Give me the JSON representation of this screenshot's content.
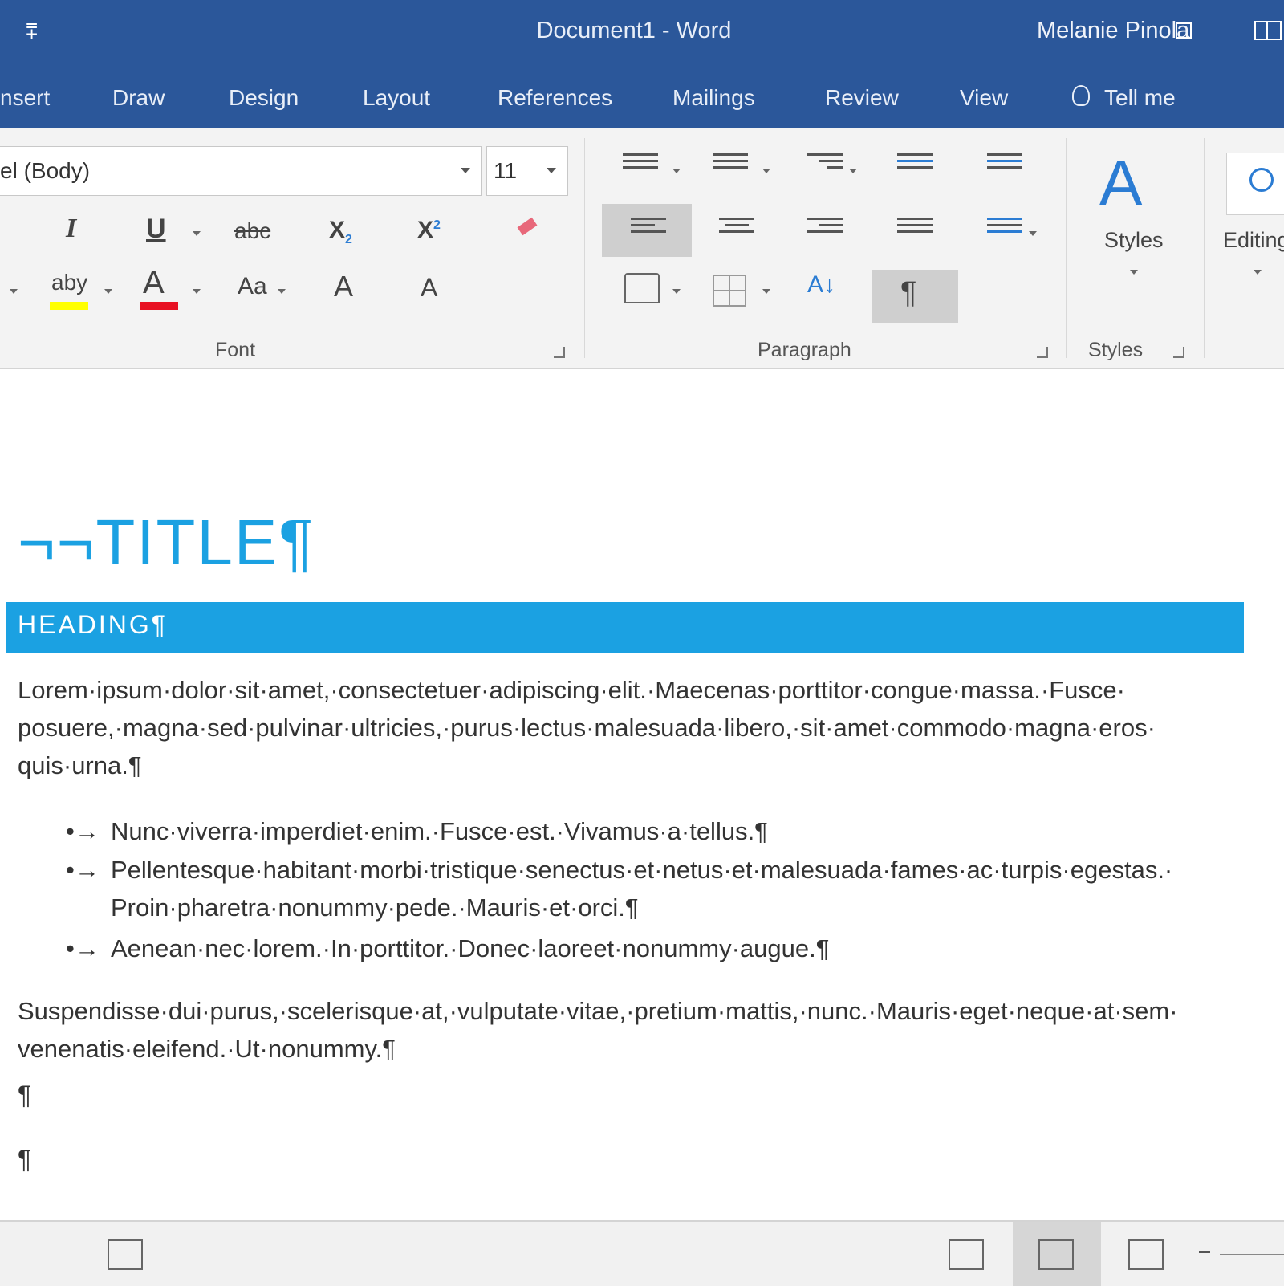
{
  "window": {
    "title": "Document1 - Word",
    "user": "Melanie Pinola",
    "qat_glyph": "⩱"
  },
  "tabs": [
    "nsert",
    "Draw",
    "Design",
    "Layout",
    "References",
    "Mailings",
    "Review",
    "View",
    "Tell me"
  ],
  "font": {
    "name": "el (Body)",
    "size": "11"
  },
  "groups": {
    "font": "Font",
    "paragraph": "Paragraph",
    "styles": "Styles",
    "editing": "Editing",
    "styles_button": "Styles"
  },
  "font_buttons": {
    "italic": "I",
    "underline": "U",
    "strike": "abc",
    "sub": "X",
    "sub_small": "2",
    "super": "X",
    "super_small": "2",
    "highlight": "aby",
    "color": "A",
    "case": "Aa",
    "grow": "A",
    "shrink": "A"
  },
  "paragraph_buttons": {
    "sort": "A↓",
    "show_marks": "¶"
  },
  "document": {
    "title": "¬¬TITLE¶",
    "heading": "HEADING¶",
    "para1": "Lorem·ipsum·dolor·sit·amet,·consectetuer·adipiscing·elit.·Maecenas·porttitor·congue·massa.·Fusce· posuere,·magna·sed·pulvinar·ultricies,·purus·lectus·malesuada·libero,·sit·amet·commodo·magna·eros· quis·urna.¶",
    "bullets": [
      "Nunc·viverra·imperdiet·enim.·Fusce·est.·Vivamus·a·tellus.¶",
      "Pellentesque·habitant·morbi·tristique·senectus·et·netus·et·malesuada·fames·ac·turpis·egestas.· Proin·pharetra·nonummy·pede.·Mauris·et·orci.¶",
      "Aenean·nec·lorem.·In·porttitor.·Donec·laoreet·nonummy·augue.¶"
    ],
    "bullet_marker": "•→",
    "para2": "Suspendisse·dui·purus,·scelerisque·at,·vulputate·vitae,·pretium·mattis,·nunc.·Mauris·eget·neque·at·sem· venenatis·eleifend.·Ut·nonummy.¶",
    "empty_mark": "¶"
  },
  "colors": {
    "accent": "#2b579a",
    "heading": "#1ba1e2",
    "highlight": "#ffff00",
    "font_color": "#e81123"
  }
}
